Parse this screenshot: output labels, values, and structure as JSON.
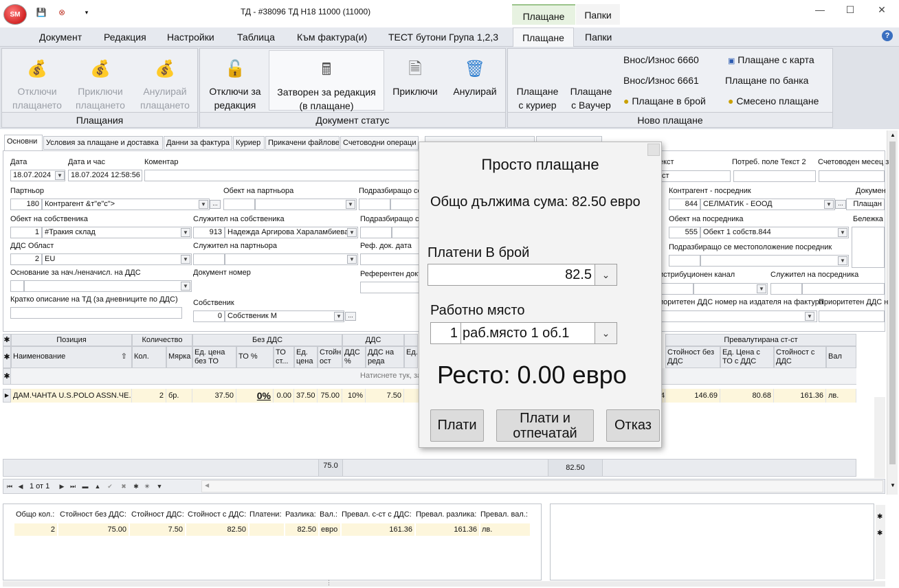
{
  "app": {
    "logo_text": "SM",
    "window_title": "ТД - #38096 ТД Н18 11000 (11000)",
    "context_tabs": [
      "Плащане",
      "Папки"
    ]
  },
  "menu": {
    "items": [
      "Документ",
      "Редакция",
      "Настройки",
      "Таблица",
      "Към фактура(и)",
      "ТЕСТ бутони Група 1,2,3",
      "Плащане",
      "Папки"
    ]
  },
  "ribbon": {
    "payments": {
      "label": "Плащания",
      "unlock_l1": "Отключи",
      "unlock_l2": "плащането",
      "finish_l1": "Приключи",
      "finish_l2": "плащането",
      "cancel_l1": "Анулирай",
      "cancel_l2": "плащането"
    },
    "status": {
      "label": "Документ статус",
      "unlock_l1": "Отключи за",
      "unlock_l2": "редакция",
      "closed_l1": "Затворен за редакция",
      "closed_l2": "(в плащане)",
      "finish": "Приключи",
      "cancel": "Анулирай"
    },
    "new_payment": {
      "label": "Ново плащане",
      "courier_l1": "Плащане",
      "courier_l2": "с куриер",
      "voucher_l1": "Плащане",
      "voucher_l2": "с Ваучер",
      "in_out_6660": "Внос/Износ 6660",
      "in_out_6661": "Внос/Износ 6661",
      "cash": "Плащане в брой",
      "card": "Плащане с карта",
      "bank": "Плащане по банка",
      "mixed": "Смесено плащане"
    }
  },
  "tabs": [
    "Основни",
    "Условия за плащане и доставка",
    "Данни за фактура",
    "Куриер",
    "Прикачени файлове",
    "Счетоводни операци"
  ],
  "form": {
    "date_label": "Дата",
    "date": "18.07.2024",
    "datetime_label": "Дата и час",
    "datetime": "18.07.2024 12:58:56",
    "comment_label": "Коментар",
    "text_label": "екст",
    "text_val": "ст",
    "user_text2_label": "Потреб. поле Текст 2",
    "acc_month_label": "Счетоводен месец з",
    "partner_label": "Партньор",
    "partner_id": "180",
    "partner_name": "Контрагент &т\"е\"с\">",
    "partner_object_label": "Обект на партньора",
    "sub_loc_label": "Подразбиращо се",
    "intermediary_label": "Контрагент - посредник",
    "intermediary_id": "844",
    "intermediary_name": "СЕЛМАТИК - ЕООД",
    "doc_label": "Докумен",
    "doc_val": "Плащан",
    "owner_object_label": "Обект на собственика",
    "owner_object_id": "1",
    "owner_object_name": "#Тракия склад",
    "owner_employee_label": "Служител на собственика",
    "owner_employee_id": "913",
    "owner_employee_name": "Надежда Аргирова Хараламбиева",
    "sub_loc2_label": "Подразбиращо с",
    "intermediary_object_label": "Обект на посредника",
    "intermediary_object_id": "555",
    "intermediary_object_name": "Обект 1 собств.844",
    "note_label": "Бележка",
    "vat_area_label": "ДДС Област",
    "vat_area_id": "2",
    "vat_area_name": "EU",
    "partner_employee_label": "Служител на партньора",
    "ref_doc_date_label": "Реф. док. дата",
    "intermediary_subloc_label": "Подразбиращо се местоположение посредник",
    "vat_basis_label": "Основание за нач./неначисл. на ДДС",
    "doc_number_label": "Документ номер",
    "ref_doc_label": "Референтен докт",
    "dist_channel_label": "истрибуционен канал",
    "intermediary_employee_label": "Служител на посредника",
    "short_desc_label": "Кратко описание на ТД (за дневниците по ДДС)",
    "owner_label": "Собственик",
    "owner_id": "0",
    "owner_name": "Собственик М",
    "priority_vat_label": "иоритетен ДДС номер на издателя на фактура",
    "priority_vat2_label": "Приоритетен ДДС н"
  },
  "grid": {
    "groups": [
      "Позиция",
      "Количество",
      "Без ДДС",
      "ДДС",
      "Превалутирана ст-ст"
    ],
    "columns": [
      "Наименование",
      "Кол.",
      "Мярка",
      "Ед. цена без ТО",
      "ТО %",
      "ТО ст...",
      "Ед. цена",
      "Стойн ост",
      "ДДС %",
      "ДДС на реда",
      "Ед."
    ],
    "right_columns": [
      "Стойност без ДДС",
      "Ед. Цена с ТО с ДДС",
      "Стойност с ДДС",
      "Вал"
    ],
    "hint": "Натиснете тук, за",
    "row": {
      "name": "ДАМ.ЧАНТА U.S.POLO ASSN.ЧЕ...",
      "qty": "2",
      "unit": "бр.",
      "price": "37.50",
      "discount": "0%",
      "disc_val": "0.00",
      "unit_price": "37.50",
      "value": "75.00",
      "vat_pct": "10%",
      "vat_row": "7.50",
      "r_frag": "4",
      "r_value": "146.69",
      "r_unit_price": "80.68",
      "r_total": "161.36",
      "r_cur": "лв."
    },
    "footer_value": "75.0",
    "footer_total": "82.50"
  },
  "nav": {
    "record": "1 от 1"
  },
  "totals": {
    "headers": [
      "Общо кол.:",
      "Стойност без ДДС:",
      "Стойност ДДС:",
      "Стойност с ДДС:",
      "Платени:",
      "Разлика:",
      "Вал.:",
      "Превал.  с-ст с ДДС:",
      "Превал. разлика:",
      "Превал. вал.:"
    ],
    "values": [
      "2",
      "75.00",
      "7.50",
      "82.50",
      "",
      "82.50",
      "евро",
      "161.36",
      "161.36",
      "лв."
    ]
  },
  "modal": {
    "title": "Просто плащане",
    "total_due": "Общо дължима сума: 82.50 евро",
    "paid_label": "Платени В брой",
    "paid_value": "82.5",
    "workstation_label": "Работно място",
    "workstation_id": "1",
    "workstation_name": "раб.място 1 об.1",
    "change": "Ресто: 0.00 евро",
    "pay": "Плати",
    "pay_print_l1": "Плати и",
    "pay_print_l2": "отпечатай",
    "cancel": "Отказ"
  }
}
